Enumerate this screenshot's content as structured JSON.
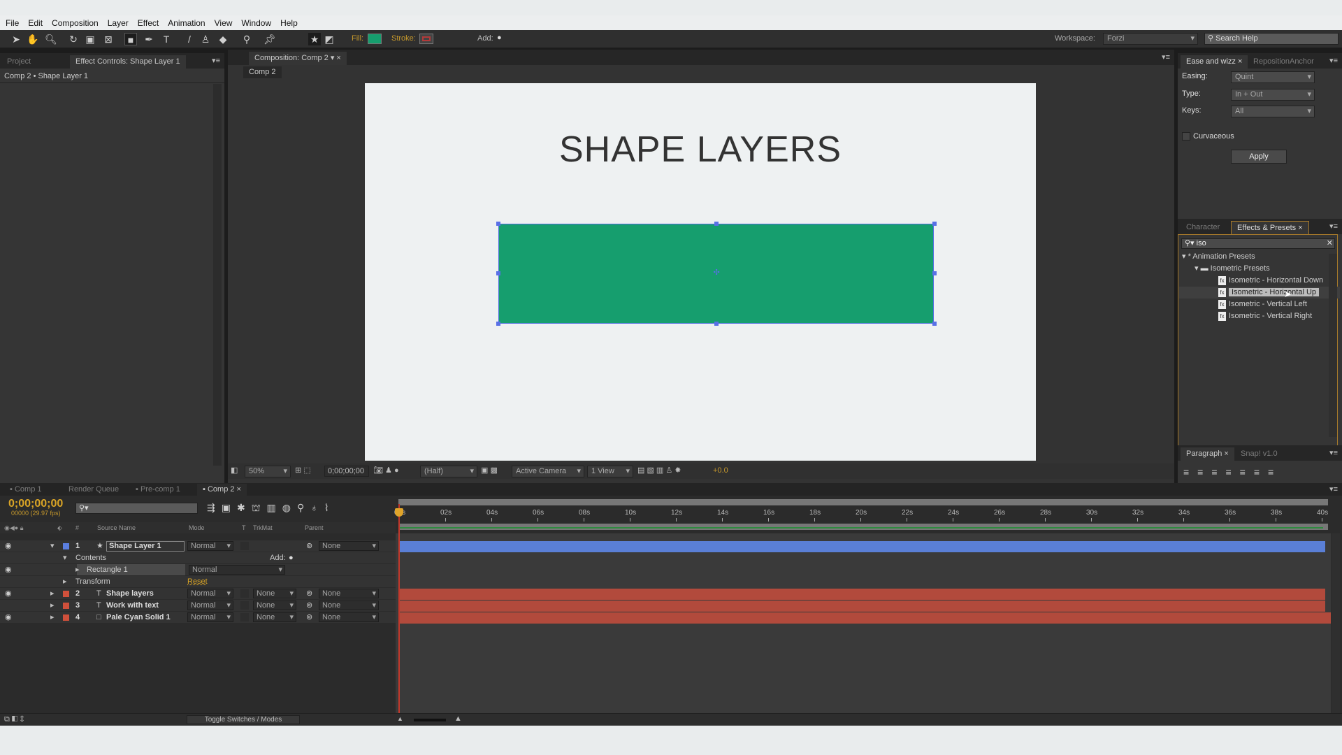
{
  "menu": [
    "File",
    "Edit",
    "Composition",
    "Layer",
    "Effect",
    "Animation",
    "View",
    "Window",
    "Help"
  ],
  "toolbar": {
    "fill_label": "Fill:",
    "stroke_label": "Stroke:",
    "add_label": "Add:",
    "fill_color": "#169e6e",
    "stroke_color": "#b33a3a",
    "workspace_label": "Workspace:",
    "workspace_value": "Forzi",
    "search_placeholder": "Search Help"
  },
  "left_panel": {
    "tabs": [
      "Project",
      "Effect Controls: Shape Layer 1"
    ],
    "breadcrumb": "Comp 2 • Shape Layer 1"
  },
  "comp_panel": {
    "tab": "Composition: Comp 2",
    "subtab": "Comp 2",
    "canvas_title": "SHAPE LAYERS",
    "shape_color": "#169e6e",
    "zoom": "50%",
    "timecode": "0;00;00;00",
    "resolution": "(Half)",
    "camera": "Active Camera",
    "views": "1 View",
    "exposure": "+0.0"
  },
  "ease_panel": {
    "tabs": [
      "Ease and wizz",
      "RepositionAnchor"
    ],
    "easing_label": "Easing:",
    "easing_value": "Quint",
    "type_label": "Type:",
    "type_value": "In + Out",
    "keys_label": "Keys:",
    "keys_value": "All",
    "curvaceous_label": "Curvaceous",
    "curvaceous_checked": false,
    "apply_label": "Apply"
  },
  "effects_panel": {
    "tabs": [
      "Character",
      "Effects & Presets"
    ],
    "search_value": "iso",
    "tree": [
      {
        "label": "* Animation Presets",
        "level": 0,
        "type": "group"
      },
      {
        "label": "Isometric Presets",
        "level": 1,
        "type": "folder"
      },
      {
        "label": "Isometric - Horizontal Down",
        "level": 2,
        "type": "preset"
      },
      {
        "label": "Isometric - Horizontal Up",
        "level": 2,
        "type": "preset",
        "selected": true
      },
      {
        "label": "Isometric - Vertical Left",
        "level": 2,
        "type": "preset"
      },
      {
        "label": "Isometric - Vertical Right",
        "level": 2,
        "type": "preset"
      }
    ]
  },
  "paragraph_panel": {
    "tabs": [
      "Paragraph",
      "Snap! v1.0"
    ]
  },
  "timeline": {
    "tabs": [
      "Comp 1",
      "Render Queue",
      "Pre-comp 1",
      "Comp 2"
    ],
    "timecode": "0;00;00;00",
    "fps": "00000 (29.97 fps)",
    "columns": {
      "num": "#",
      "source": "Source Name",
      "mode": "Mode",
      "t": "T",
      "trkmat": "TrkMat",
      "parent": "Parent"
    },
    "ruler": [
      "00s",
      "02s",
      "04s",
      "06s",
      "08s",
      "10s",
      "12s",
      "14s",
      "16s",
      "18s",
      "20s",
      "22s",
      "24s",
      "26s",
      "28s",
      "30s",
      "32s",
      "34s",
      "36s",
      "38s",
      "40s"
    ],
    "layers": [
      {
        "num": "1",
        "name": "Shape Layer 1",
        "mode": "Normal",
        "trkmat": "",
        "parent": "None",
        "color": "#5b7fe0",
        "bar": "#5a7fd6",
        "icon": "★"
      },
      {
        "num": "2",
        "name": "Shape layers",
        "mode": "Normal",
        "trkmat": "None",
        "parent": "None",
        "color": "#d0503b",
        "bar": "#b24a3c",
        "icon": "T"
      },
      {
        "num": "3",
        "name": "Work with text",
        "mode": "Normal",
        "trkmat": "None",
        "parent": "None",
        "color": "#d0503b",
        "bar": "#b24a3c",
        "icon": "T"
      },
      {
        "num": "4",
        "name": "Pale Cyan Solid 1",
        "mode": "Normal",
        "trkmat": "None",
        "parent": "None",
        "color": "#d0503b",
        "bar": "#b24a3c",
        "icon": "□"
      }
    ],
    "contents_label": "Contents",
    "add_label": "Add:",
    "rectangle_label": "Rectangle 1",
    "rectangle_mode": "Normal",
    "transform_label": "Transform",
    "reset_label": "Reset",
    "toggle_label": "Toggle Switches / Modes"
  }
}
